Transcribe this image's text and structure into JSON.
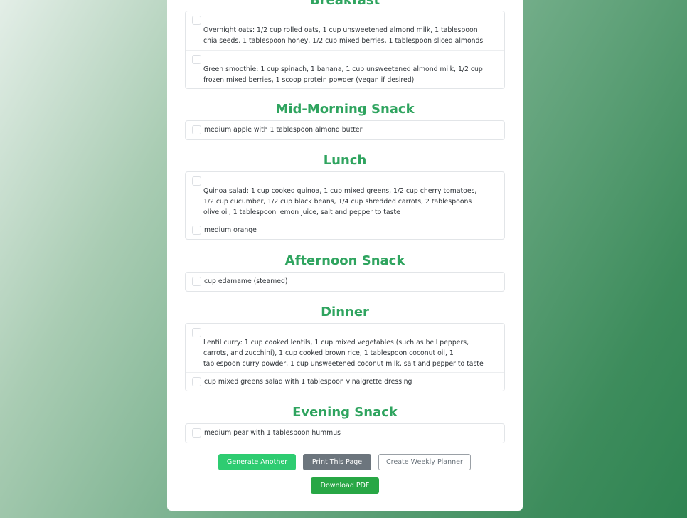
{
  "sections": [
    {
      "title": "Breakfast",
      "items": [
        "Overnight oats: 1/2 cup rolled oats, 1 cup unsweetened almond milk, 1 tablespoon chia seeds, 1 tablespoon honey, 1/2 cup mixed berries, 1 tablespoon sliced almonds",
        "Green smoothie: 1 cup spinach, 1 banana, 1 cup unsweetened almond milk, 1/2 cup frozen mixed berries, 1 scoop protein powder (vegan if desired)"
      ]
    },
    {
      "title": "Mid-Morning Snack",
      "items": [
        "medium apple with 1 tablespoon almond butter"
      ]
    },
    {
      "title": "Lunch",
      "items": [
        "Quinoa salad: 1 cup cooked quinoa, 1 cup mixed greens, 1/2 cup cherry tomatoes, 1/2 cup cucumber, 1/2 cup black beans, 1/4 cup shredded carrots, 2 tablespoons olive oil, 1 tablespoon lemon juice, salt and pepper to taste",
        "medium orange"
      ]
    },
    {
      "title": "Afternoon Snack",
      "items": [
        "cup edamame (steamed)"
      ]
    },
    {
      "title": "Dinner",
      "items": [
        "Lentil curry: 1 cup cooked lentils, 1 cup mixed vegetables (such as bell peppers, carrots, and zucchini), 1 cup cooked brown rice, 1 tablespoon coconut oil, 1 tablespoon curry powder, 1 cup unsweetened coconut milk, salt and pepper to taste",
        "cup mixed greens salad with 1 tablespoon vinaigrette dressing"
      ]
    },
    {
      "title": "Evening Snack",
      "items": [
        "medium pear with 1 tablespoon hummus"
      ]
    }
  ],
  "buttons": {
    "generate": "Generate Another",
    "print": "Print This Page",
    "weekly": "Create Weekly Planner",
    "pdf": "Download PDF"
  },
  "colors": {
    "heading": "#2fa45f",
    "generate_button": "#2ecc71",
    "print_button": "#6c757d",
    "pdf_button": "#28a745"
  }
}
